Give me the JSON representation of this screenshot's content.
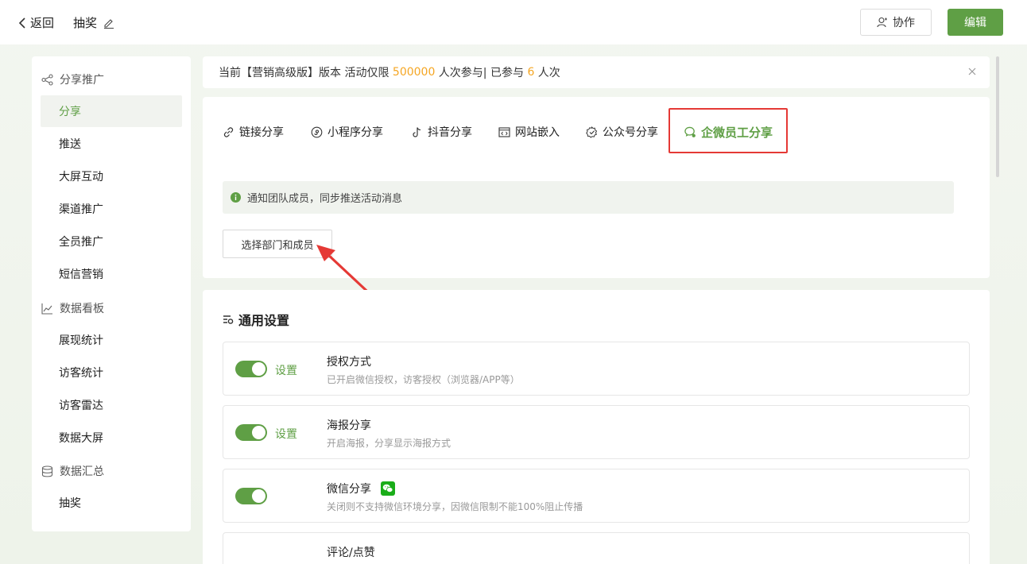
{
  "header": {
    "back_label": "返回",
    "page_title": "抽奖",
    "collab_label": "协作",
    "edit_label": "编辑"
  },
  "sidebar": {
    "groups": [
      {
        "label": "分享推广",
        "icon": "share-icon"
      },
      {
        "label": "数据看板",
        "icon": "chart-icon"
      },
      {
        "label": "数据汇总",
        "icon": "database-icon"
      }
    ],
    "items": [
      {
        "label": "分享",
        "active": true
      },
      {
        "label": "推送"
      },
      {
        "label": "大屏互动"
      },
      {
        "label": "渠道推广"
      },
      {
        "label": "全员推广"
      },
      {
        "label": "短信营销"
      },
      {
        "label": "展现统计"
      },
      {
        "label": "访客统计"
      },
      {
        "label": "访客雷达"
      },
      {
        "label": "数据大屏"
      },
      {
        "label": "抽奖"
      }
    ]
  },
  "notice": {
    "prefix": "当前【营销高级版】版本 活动仅限 ",
    "limit": "500000",
    "middle": " 人次参与| 已参与 ",
    "joined": "6",
    "suffix": " 人次"
  },
  "share": {
    "tabs": [
      {
        "label": "链接分享",
        "icon": "link-icon"
      },
      {
        "label": "小程序分享",
        "icon": "miniprogram-icon"
      },
      {
        "label": "抖音分享",
        "icon": "tiktok-icon"
      },
      {
        "label": "网站嵌入",
        "icon": "code-window-icon"
      },
      {
        "label": "公众号分享",
        "icon": "official-account-icon"
      },
      {
        "label": "企微员工分享",
        "icon": "wecom-icon",
        "active": true
      }
    ],
    "tip": "通知团队成员，同步推送活动消息",
    "select_button": "选择部门和成员"
  },
  "settings": {
    "title": "通用设置",
    "rows": [
      {
        "title": "授权方式",
        "desc": "已开启微信授权，访客授权（浏览器/APP等）",
        "link": "设置",
        "enabled": true
      },
      {
        "title": "海报分享",
        "desc": "开启海报，分享显示海报方式",
        "link": "设置",
        "enabled": true
      },
      {
        "title": "微信分享",
        "desc": "关闭则不支持微信环境分享，因微信限制不能100%阻止传播",
        "link": "",
        "enabled": true,
        "badge_icon": "wechat-icon"
      },
      {
        "title": "评论/点赞",
        "desc": "",
        "link": "",
        "enabled": true
      }
    ]
  },
  "colors": {
    "accent": "#5f9f45",
    "highlight": "#f5a623",
    "annotation": "#e53935"
  }
}
